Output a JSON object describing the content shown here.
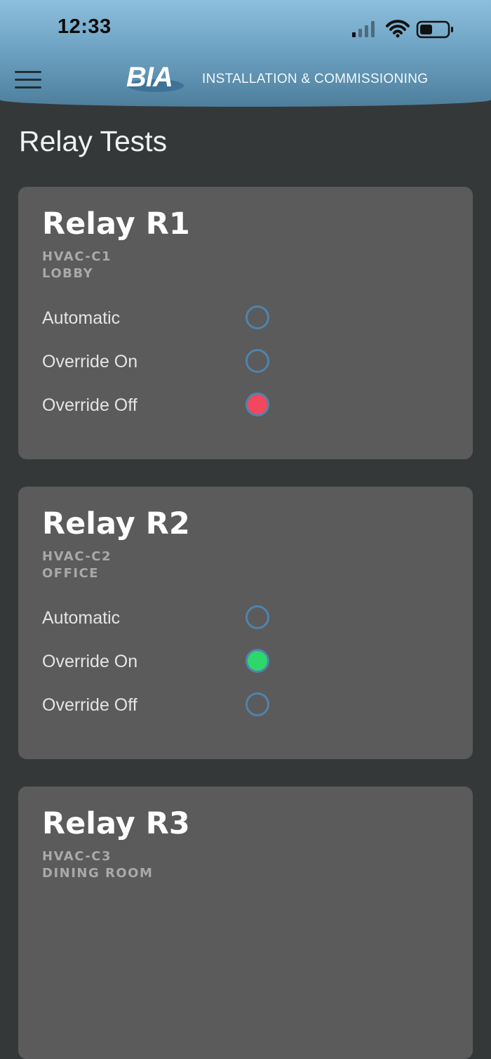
{
  "status_bar": {
    "time": "12:33"
  },
  "header": {
    "logo_text": "BIA",
    "subtitle": "INSTALLATION & COMMISSIONING"
  },
  "page": {
    "title": "Relay Tests"
  },
  "relays": [
    {
      "name": "Relay R1",
      "circuit": "HVAC-C1",
      "location": "LOBBY",
      "options": [
        "Automatic",
        "Override On",
        "Override Off"
      ],
      "selected": "Override Off",
      "selected_color": "#f2475c"
    },
    {
      "name": "Relay R2",
      "circuit": "HVAC-C2",
      "location": "OFFICE",
      "options": [
        "Automatic",
        "Override On",
        "Override Off"
      ],
      "selected": "Override On",
      "selected_color": "#2ed76b"
    },
    {
      "name": "Relay R3",
      "circuit": "HVAC-C3",
      "location": "DINING ROOM"
    }
  ],
  "colors": {
    "background": "#353839",
    "card": "#5b5b5b",
    "radio_border": "#4f84ab",
    "header_top": "#8bbfdc",
    "header_bottom": "#4d7f9c"
  }
}
